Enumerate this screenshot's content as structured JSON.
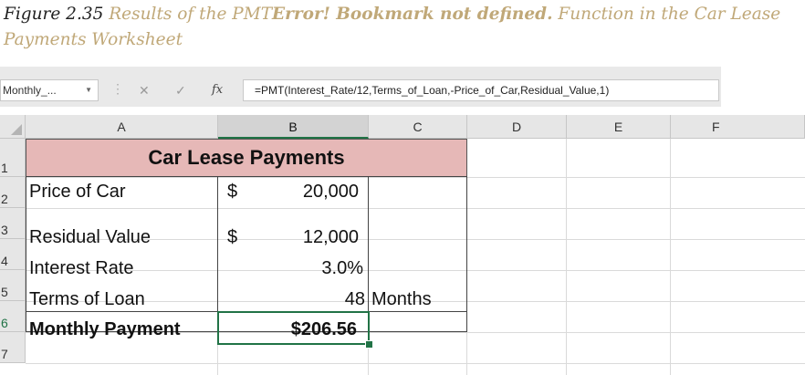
{
  "caption": {
    "figure_label": "Figure 2.35",
    "text_before": " Results of the PMT",
    "error_text": "Error! Bookmark not defined.",
    "text_after": " Function in the Car Lease Payments Worksheet"
  },
  "formula_bar": {
    "name_box": "Monthly_...",
    "cancel_glyph": "✕",
    "enter_glyph": "✓",
    "fx_label": "fx",
    "formula": "=PMT(Interest_Rate/12,Terms_of_Loan,-Price_of_Car,Residual_Value,1)"
  },
  "columns": [
    "A",
    "B",
    "C",
    "D",
    "E",
    "F"
  ],
  "rows": [
    "1",
    "2",
    "3",
    "4",
    "5",
    "6",
    "7"
  ],
  "table": {
    "title": "Car Lease Payments",
    "rows": [
      {
        "label": "Price of Car",
        "currency": "$",
        "value": "20,000",
        "unit": ""
      },
      {
        "label": "Residual Value",
        "currency": "$",
        "value": "12,000",
        "unit": ""
      },
      {
        "label": "Interest Rate",
        "currency": "",
        "value": "3.0%",
        "unit": ""
      },
      {
        "label": "Terms of Loan",
        "currency": "",
        "value": "48",
        "unit": "Months"
      },
      {
        "label": "Monthly Payment",
        "currency": "",
        "value": "$206.56",
        "unit": ""
      }
    ]
  },
  "colors": {
    "title_fill": "#e6b8b7",
    "selection_green": "#217346",
    "caption_tan": "#c0a878"
  }
}
